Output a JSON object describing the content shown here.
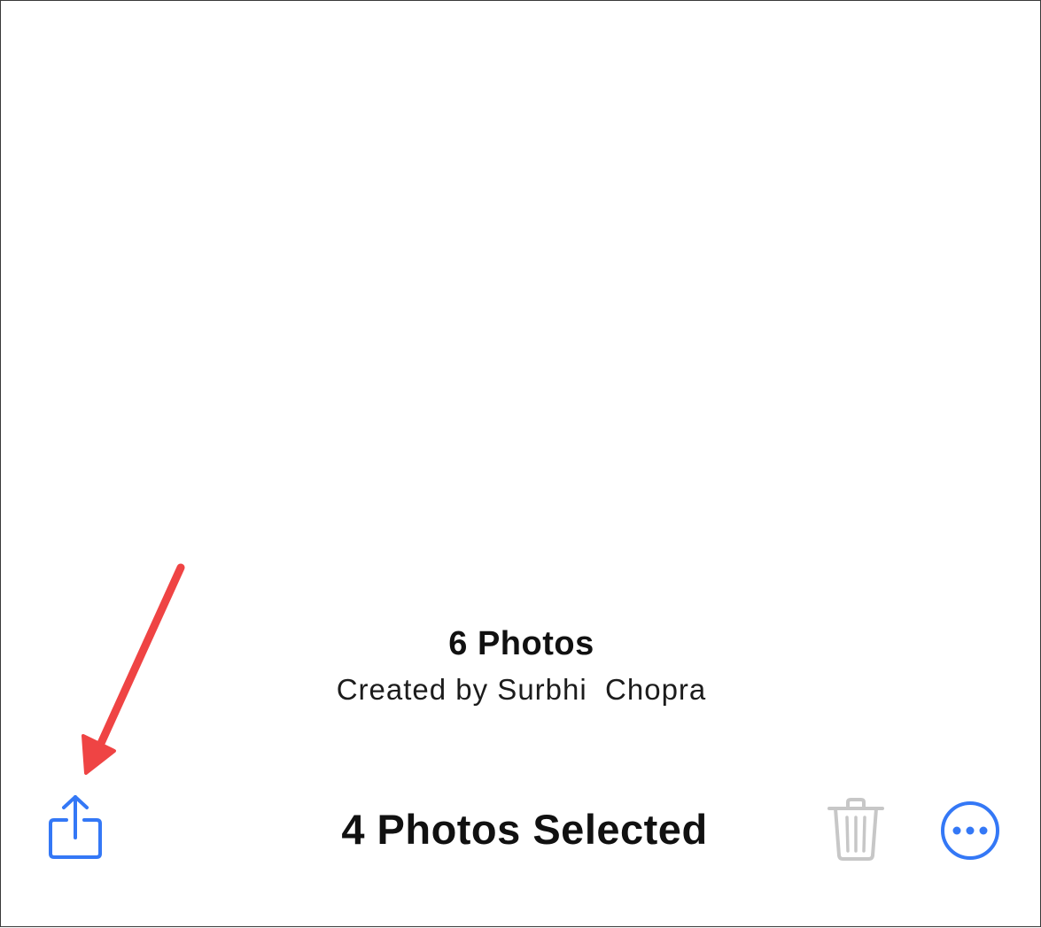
{
  "album": {
    "count_label": "6 Photos",
    "creator_label": "Created by Surbhi  Chopra"
  },
  "toolbar": {
    "selection_label": "4 Photos Selected",
    "share_icon": "share-icon",
    "trash_icon": "trash-icon",
    "more_icon": "ellipsis-circle-icon",
    "trash_state": "disabled"
  },
  "colors": {
    "accent": "#3478f6",
    "disabled": "#c7c7c7",
    "annotation": "#ef4444",
    "text": "#111111"
  }
}
